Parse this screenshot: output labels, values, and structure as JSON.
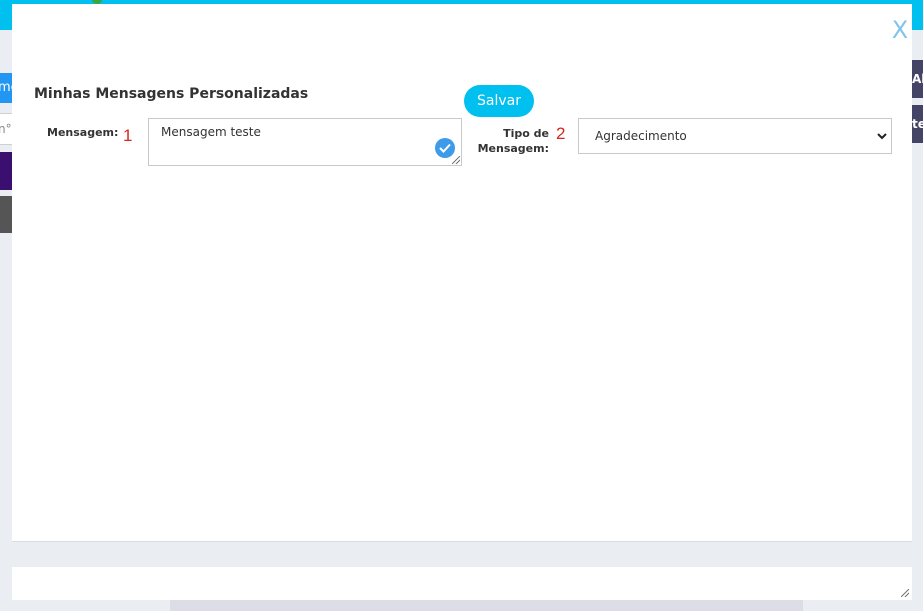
{
  "background": {
    "left_button_text": "me",
    "left_field_text": "n°",
    "right_button_1_text": "Al",
    "right_button_2_text": "te"
  },
  "modal": {
    "close_label": "X",
    "title": "Minhas Mensagens Personalizadas",
    "save_label": "Salvar",
    "message_label": "Mensagem:",
    "message_marker": "1",
    "message_value": "Mensagem teste",
    "type_label": "Tipo de Mensagem:",
    "type_marker": "2",
    "type_selected": "Agradecimento"
  },
  "colors": {
    "accent": "#00c0ef",
    "close": "#7fc4ec",
    "marker": "#d9261c",
    "check": "#3d9be9"
  },
  "icons": {
    "check": "check-circle-icon",
    "chevron": "chevron-down-icon",
    "close": "close-icon"
  }
}
